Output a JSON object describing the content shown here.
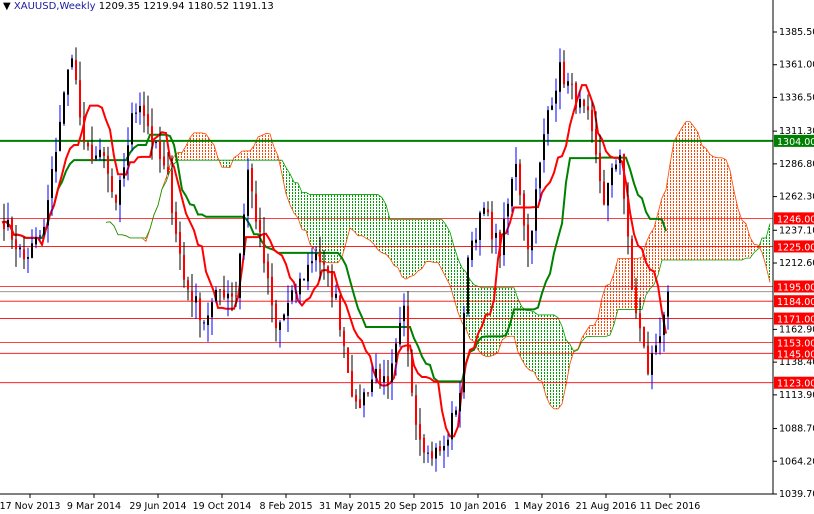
{
  "header": {
    "symbol": "XAUUSD,Weekly",
    "ohlc": "1209.35 1219.94 1180.52 1191.13"
  },
  "colors": {
    "bull": "#0000ff",
    "bear": "#ff0000",
    "tenkan": "#ff0000",
    "kijun": "#008000",
    "cloud_up": "#ff4500",
    "cloud_dn": "#00a000",
    "level": "#ff0000",
    "level_green": "#008000"
  },
  "chart_data": {
    "type": "candlestick",
    "title": "XAUUSD,Weekly",
    "indicator": "Ichimoku Kinko Hyo",
    "ylim": [
      1039.7,
      1397
    ],
    "y_ticks": [
      "1385.50",
      "1361.00",
      "1336.50",
      "1311.30",
      "1286.80",
      "1262.30",
      "1237.10",
      "1212.60",
      "1162.90",
      "1138.40",
      "1113.90",
      "1088.70",
      "1064.20",
      "1039.70"
    ],
    "x_ticks": [
      "17 Nov 2013",
      "9 Mar 2014",
      "29 Jun 2014",
      "19 Oct 2014",
      "8 Feb 2015",
      "31 May 2015",
      "20 Sep 2015",
      "10 Jan 2016",
      "1 May 2016",
      "21 Aug 2016",
      "11 Dec 2016"
    ],
    "x_tick_weeks": [
      7,
      23,
      39,
      55,
      71,
      87,
      103,
      119,
      135,
      151,
      167
    ],
    "close_keypoints": [
      [
        0,
        1245
      ],
      [
        5,
        1215
      ],
      [
        10,
        1237
      ],
      [
        14,
        1320
      ],
      [
        17,
        1372
      ],
      [
        20,
        1297
      ],
      [
        25,
        1290
      ],
      [
        28,
        1252
      ],
      [
        32,
        1320
      ],
      [
        34,
        1335
      ],
      [
        38,
        1297
      ],
      [
        41,
        1275
      ],
      [
        45,
        1200
      ],
      [
        50,
        1170
      ],
      [
        54,
        1192
      ],
      [
        58,
        1190
      ],
      [
        61,
        1282
      ],
      [
        64,
        1230
      ],
      [
        68,
        1162
      ],
      [
        73,
        1192
      ],
      [
        78,
        1222
      ],
      [
        83,
        1185
      ],
      [
        88,
        1102
      ],
      [
        93,
        1132
      ],
      [
        96,
        1117
      ],
      [
        100,
        1177
      ],
      [
        103,
        1095
      ],
      [
        106,
        1069
      ],
      [
        110,
        1073
      ],
      [
        114,
        1117
      ],
      [
        116,
        1222
      ],
      [
        120,
        1252
      ],
      [
        124,
        1222
      ],
      [
        128,
        1290
      ],
      [
        131,
        1222
      ],
      [
        136,
        1327
      ],
      [
        139,
        1357
      ],
      [
        143,
        1335
      ],
      [
        146,
        1320
      ],
      [
        150,
        1260
      ],
      [
        154,
        1297
      ],
      [
        157,
        1192
      ],
      [
        161,
        1132
      ],
      [
        164,
        1162
      ],
      [
        166,
        1191
      ]
    ],
    "levels": [
      {
        "price": 1304.0,
        "label": "1304.00",
        "color": "green"
      },
      {
        "price": 1246.0,
        "label": "1246.00",
        "color": "red"
      },
      {
        "price": 1225.0,
        "label": "1225.00",
        "color": "red"
      },
      {
        "price": 1195.0,
        "label": "1195.00",
        "color": "red"
      },
      {
        "price": 1184.0,
        "label": "1184.00",
        "color": "red"
      },
      {
        "price": 1171.0,
        "label": "1171.00",
        "color": "red"
      },
      {
        "price": 1153.0,
        "label": "1153.00",
        "color": "red"
      },
      {
        "price": 1145.0,
        "label": "1145.00",
        "color": "red"
      },
      {
        "price": 1123.0,
        "label": "1123.00",
        "color": "red"
      }
    ],
    "current_price": 1191.13
  }
}
